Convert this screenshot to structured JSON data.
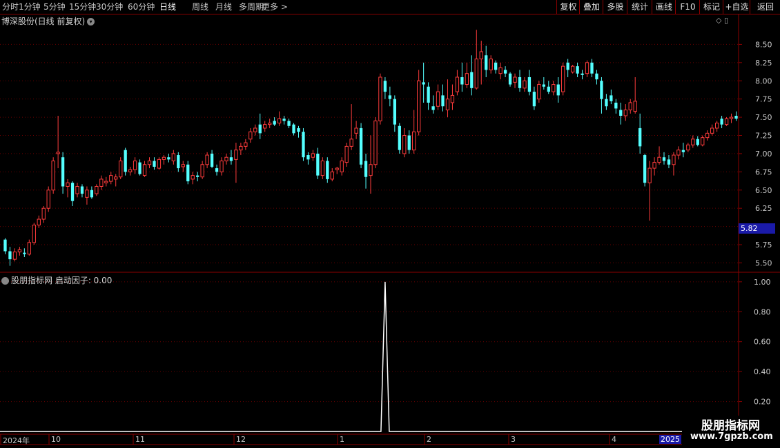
{
  "toolbar": {
    "periods": [
      "分时",
      "1分钟",
      "5分钟",
      "15分钟",
      "30分钟",
      "60分钟",
      "日线",
      "周线",
      "月线",
      "多周期",
      "更多 >"
    ],
    "active_period": "日线",
    "right_buttons": [
      "复权",
      "叠加",
      "多股",
      "统计",
      "画线",
      "F10",
      "标记",
      "+自选",
      "返回"
    ]
  },
  "main_chart": {
    "title": "博深股份(日线 前复权)",
    "current_price": "5.82",
    "y_labels": [
      "8.50",
      "8.25",
      "8.00",
      "7.75",
      "7.50",
      "7.25",
      "7.00",
      "6.75",
      "6.50",
      "6.25",
      "6.00",
      "5.75",
      "5.50"
    ]
  },
  "indicator": {
    "title": "股朋指标网  启动因子: 0.00",
    "y_labels": [
      "1.00",
      "0.80",
      "0.60",
      "0.40",
      "0.20"
    ]
  },
  "x_axis": {
    "labels": [
      "2024年",
      "10",
      "11",
      "12",
      "1",
      "2",
      "3",
      "4"
    ],
    "end_label": "2025"
  },
  "watermark": {
    "line1": "股朋指标网",
    "line2": "www.7gpzb.com"
  },
  "colors": {
    "up": "#ff3c3c",
    "down": "#54ffff",
    "grid": "#6b0000",
    "axis_text": "#c8c8c8",
    "panel_border": "#8b0000"
  },
  "chart_data": [
    {
      "type": "candlestick",
      "title": "博深股份(日线 前复权)",
      "ylim": [
        5.4,
        8.75
      ],
      "y_ticks": [
        8.5,
        8.25,
        8.0,
        7.75,
        7.5,
        7.25,
        7.0,
        6.75,
        6.5,
        6.25,
        6.0,
        5.75,
        5.5
      ],
      "candles": [
        [
          5.82,
          5.84,
          5.62,
          5.66
        ],
        [
          5.66,
          5.72,
          5.46,
          5.55
        ],
        [
          5.55,
          5.7,
          5.52,
          5.65
        ],
        [
          5.65,
          5.72,
          5.6,
          5.68
        ],
        [
          5.64,
          5.7,
          5.58,
          5.62
        ],
        [
          5.62,
          5.82,
          5.6,
          5.78
        ],
        [
          5.78,
          6.05,
          5.75,
          6.02
        ],
        [
          6.02,
          6.15,
          5.98,
          6.1
        ],
        [
          6.1,
          6.28,
          6.05,
          6.25
        ],
        [
          6.25,
          6.55,
          6.2,
          6.5
        ],
        [
          6.5,
          6.95,
          6.45,
          6.9
        ],
        [
          7.0,
          7.52,
          6.8,
          7.02
        ],
        [
          6.95,
          7.02,
          6.45,
          6.55
        ],
        [
          6.55,
          6.65,
          6.4,
          6.6
        ],
        [
          6.6,
          6.62,
          6.28,
          6.35
        ],
        [
          6.45,
          6.6,
          6.4,
          6.55
        ],
        [
          6.55,
          6.58,
          6.4,
          6.45
        ],
        [
          6.4,
          6.55,
          6.3,
          6.5
        ],
        [
          6.5,
          6.55,
          6.38,
          6.4
        ],
        [
          6.45,
          6.58,
          6.42,
          6.55
        ],
        [
          6.55,
          6.7,
          6.5,
          6.65
        ],
        [
          6.6,
          6.68,
          6.55,
          6.62
        ],
        [
          6.62,
          6.75,
          6.58,
          6.7
        ],
        [
          6.65,
          6.72,
          6.55,
          6.68
        ],
        [
          6.68,
          6.95,
          6.65,
          6.9
        ],
        [
          7.05,
          7.08,
          6.7,
          6.75
        ],
        [
          6.75,
          6.82,
          6.7,
          6.78
        ],
        [
          6.78,
          6.95,
          6.72,
          6.9
        ],
        [
          6.88,
          6.92,
          6.7,
          6.72
        ],
        [
          6.7,
          6.9,
          6.68,
          6.85
        ],
        [
          6.85,
          6.95,
          6.8,
          6.9
        ],
        [
          6.9,
          6.95,
          6.78,
          6.82
        ],
        [
          6.8,
          6.95,
          6.78,
          6.92
        ],
        [
          6.92,
          6.98,
          6.85,
          6.95
        ],
        [
          6.95,
          7.0,
          6.88,
          6.92
        ],
        [
          6.9,
          7.05,
          6.85,
          7.0
        ],
        [
          6.98,
          7.02,
          6.75,
          6.8
        ],
        [
          6.82,
          6.9,
          6.75,
          6.85
        ],
        [
          6.85,
          6.9,
          6.58,
          6.62
        ],
        [
          6.65,
          6.75,
          6.58,
          6.7
        ],
        [
          6.7,
          6.75,
          6.62,
          6.68
        ],
        [
          6.68,
          6.9,
          6.65,
          6.85
        ],
        [
          6.85,
          7.02,
          6.8,
          6.98
        ],
        [
          7.0,
          7.05,
          6.8,
          6.82
        ],
        [
          6.8,
          6.85,
          6.7,
          6.75
        ],
        [
          6.75,
          6.95,
          6.7,
          6.9
        ],
        [
          6.9,
          7.0,
          6.85,
          6.95
        ],
        [
          6.95,
          7.05,
          6.85,
          6.9
        ],
        [
          6.92,
          7.15,
          6.6,
          7.05
        ],
        [
          7.05,
          7.15,
          6.98,
          7.1
        ],
        [
          7.1,
          7.2,
          7.05,
          7.15
        ],
        [
          7.2,
          7.35,
          7.15,
          7.3
        ],
        [
          7.3,
          7.4,
          7.25,
          7.35
        ],
        [
          7.4,
          7.55,
          7.2,
          7.28
        ],
        [
          7.35,
          7.45,
          7.3,
          7.4
        ],
        [
          7.4,
          7.48,
          7.35,
          7.42
        ],
        [
          7.45,
          7.5,
          7.38,
          7.4
        ],
        [
          7.42,
          7.58,
          7.38,
          7.48
        ],
        [
          7.48,
          7.52,
          7.4,
          7.45
        ],
        [
          7.45,
          7.48,
          7.35,
          7.38
        ],
        [
          7.4,
          7.42,
          7.25,
          7.28
        ],
        [
          7.35,
          7.38,
          7.22,
          7.3
        ],
        [
          7.3,
          7.35,
          6.9,
          6.95
        ],
        [
          6.98,
          7.02,
          6.85,
          6.92
        ],
        [
          6.95,
          7.05,
          6.9,
          7.0
        ],
        [
          7.0,
          7.08,
          6.65,
          6.7
        ],
        [
          6.7,
          6.95,
          6.65,
          6.9
        ],
        [
          6.9,
          6.95,
          6.6,
          6.65
        ],
        [
          6.65,
          6.8,
          6.62,
          6.75
        ],
        [
          6.78,
          6.82,
          6.72,
          6.8
        ],
        [
          6.75,
          6.95,
          6.7,
          6.9
        ],
        [
          6.88,
          7.15,
          6.82,
          7.1
        ],
        [
          7.1,
          7.68,
          7.05,
          7.2
        ],
        [
          7.28,
          7.45,
          7.2,
          7.35
        ],
        [
          7.35,
          7.42,
          6.8,
          6.85
        ],
        [
          6.9,
          7.0,
          6.52,
          6.68
        ],
        [
          6.7,
          7.25,
          6.45,
          6.85
        ],
        [
          6.85,
          7.5,
          6.8,
          7.45
        ],
        [
          7.45,
          8.1,
          7.4,
          8.05
        ],
        [
          8.0,
          8.05,
          7.75,
          7.85
        ],
        [
          7.8,
          7.92,
          7.65,
          7.75
        ],
        [
          7.75,
          7.8,
          7.3,
          7.4
        ],
        [
          7.38,
          7.42,
          7.0,
          7.05
        ],
        [
          7.0,
          7.35,
          6.95,
          7.25
        ],
        [
          7.25,
          7.32,
          7.0,
          7.05
        ],
        [
          7.05,
          7.6,
          7.0,
          7.3
        ],
        [
          7.3,
          8.15,
          7.25,
          8.0
        ],
        [
          7.98,
          8.25,
          7.7,
          7.95
        ],
        [
          7.92,
          7.98,
          7.6,
          7.7
        ],
        [
          7.65,
          7.8,
          7.55,
          7.6
        ],
        [
          7.65,
          7.95,
          7.6,
          7.85
        ],
        [
          7.8,
          7.95,
          7.58,
          7.65
        ],
        [
          7.6,
          8.02,
          7.5,
          7.75
        ],
        [
          7.7,
          7.95,
          7.6,
          7.8
        ],
        [
          7.85,
          8.15,
          7.8,
          8.05
        ],
        [
          8.05,
          8.25,
          7.85,
          7.95
        ],
        [
          7.95,
          8.25,
          7.9,
          8.1
        ],
        [
          8.12,
          8.35,
          7.8,
          7.9
        ],
        [
          7.9,
          8.7,
          7.88,
          8.3
        ],
        [
          8.3,
          8.55,
          7.95,
          8.4
        ],
        [
          8.35,
          8.48,
          8.05,
          8.15
        ],
        [
          8.15,
          8.35,
          8.1,
          8.3
        ],
        [
          8.25,
          8.28,
          8.1,
          8.15
        ],
        [
          8.1,
          8.25,
          8.02,
          8.18
        ],
        [
          8.15,
          8.2,
          8.05,
          8.1
        ],
        [
          8.1,
          8.12,
          7.92,
          7.95
        ],
        [
          7.98,
          8.1,
          7.9,
          8.05
        ],
        [
          8.05,
          8.15,
          7.85,
          7.9
        ],
        [
          7.9,
          8.05,
          7.85,
          8.0
        ],
        [
          8.05,
          8.15,
          7.8,
          7.85
        ],
        [
          7.85,
          7.92,
          7.6,
          7.65
        ],
        [
          7.75,
          8.0,
          7.7,
          7.95
        ],
        [
          7.95,
          8.05,
          7.88,
          7.92
        ],
        [
          7.92,
          8.0,
          7.82,
          7.85
        ],
        [
          7.85,
          8.0,
          7.8,
          7.95
        ],
        [
          7.95,
          8.05,
          7.7,
          7.8
        ],
        [
          7.85,
          8.25,
          7.8,
          8.2
        ],
        [
          8.25,
          8.3,
          8.05,
          8.15
        ],
        [
          8.12,
          8.22,
          8.1,
          8.2
        ],
        [
          8.2,
          8.25,
          8.05,
          8.1
        ],
        [
          8.1,
          8.15,
          8.02,
          8.08
        ],
        [
          8.1,
          8.28,
          8.05,
          8.25
        ],
        [
          8.25,
          8.3,
          8.05,
          8.1
        ],
        [
          8.1,
          8.15,
          7.95,
          8.02
        ],
        [
          8.0,
          8.05,
          7.55,
          7.75
        ],
        [
          7.75,
          7.82,
          7.6,
          7.65
        ],
        [
          7.8,
          7.88,
          7.68,
          7.72
        ],
        [
          7.7,
          7.75,
          7.55,
          7.62
        ],
        [
          7.6,
          7.7,
          7.4,
          7.52
        ],
        [
          7.52,
          7.68,
          7.45,
          7.6
        ],
        [
          7.6,
          7.75,
          7.55,
          7.7
        ],
        [
          7.58,
          8.05,
          7.55,
          7.72
        ],
        [
          7.35,
          7.55,
          7.0,
          7.1
        ],
        [
          6.98,
          7.0,
          6.55,
          6.6
        ],
        [
          6.6,
          6.9,
          6.08,
          6.8
        ],
        [
          6.8,
          6.95,
          6.7,
          6.88
        ],
        [
          6.88,
          7.1,
          6.85,
          6.95
        ],
        [
          6.95,
          7.02,
          6.85,
          6.9
        ],
        [
          6.92,
          6.98,
          6.8,
          6.85
        ],
        [
          6.85,
          7.02,
          6.7,
          6.98
        ],
        [
          6.98,
          7.1,
          6.92,
          7.05
        ],
        [
          7.05,
          7.15,
          6.95,
          7.02
        ],
        [
          7.05,
          7.15,
          7.02,
          7.12
        ],
        [
          7.12,
          7.25,
          7.08,
          7.2
        ],
        [
          7.2,
          7.24,
          7.1,
          7.12
        ],
        [
          7.12,
          7.25,
          7.1,
          7.22
        ],
        [
          7.22,
          7.32,
          7.18,
          7.28
        ],
        [
          7.28,
          7.4,
          7.25,
          7.35
        ],
        [
          7.35,
          7.45,
          7.3,
          7.42
        ],
        [
          7.48,
          7.52,
          7.35,
          7.4
        ],
        [
          7.4,
          7.5,
          7.38,
          7.48
        ],
        [
          7.48,
          7.55,
          7.42,
          7.5
        ],
        [
          7.52,
          7.58,
          7.45,
          7.48
        ]
      ]
    },
    {
      "type": "line",
      "title": "股朋指标网 启动因子",
      "ylim": [
        0,
        1.05
      ],
      "y_ticks": [
        1.0,
        0.8,
        0.6,
        0.4,
        0.2
      ],
      "spike_index": 79,
      "values_note_free": true
    }
  ]
}
